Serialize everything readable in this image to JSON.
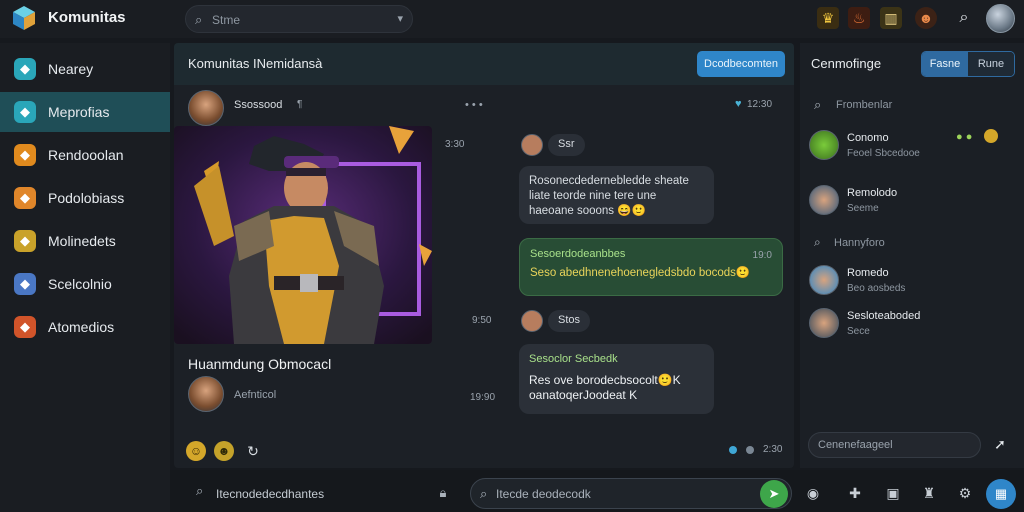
{
  "app": {
    "title": "Komunitas",
    "logo_icon": "cube-logo-icon"
  },
  "top_search": {
    "placeholder": "Stme"
  },
  "sidebar": {
    "items": [
      {
        "label": "Nearey",
        "icon": "home-icon",
        "color": "#2aa6b9"
      },
      {
        "label": "Meprofias",
        "icon": "chat-icon",
        "color": "#2aa6b9",
        "active": true
      },
      {
        "label": "Rendooolan",
        "icon": "coin-icon",
        "color": "#e08a1e"
      },
      {
        "label": "Podolobiass",
        "icon": "sword-icon",
        "color": "#e0862a"
      },
      {
        "label": "Molinedets",
        "icon": "star-icon",
        "color": "#c9a22a"
      },
      {
        "label": "Scelcolnio",
        "icon": "globe-icon",
        "color": "#4a77c4"
      },
      {
        "label": "Atomedios",
        "icon": "shield-icon",
        "color": "#d1542a"
      }
    ]
  },
  "main": {
    "title": "Komunitas INemidansà",
    "header_button": "Dcodbecomten",
    "author": {
      "name": "Ssossood",
      "flag": "¶"
    },
    "status_right": "12:30",
    "post_caption": "Huanmdung Obmocacl",
    "post_author": "Aefnticol",
    "messages": [
      {
        "time": "3:30",
        "name": "Ssr",
        "type": "chip"
      },
      {
        "text": "Rosonecdedernebledde sheate liate teorde nine tere une haeoane sooons 😄🙂",
        "type": "gray"
      },
      {
        "text_head": "Sesoerdodeanbbes",
        "time": "19:0",
        "text": "Seso abedhnenehoenegledsbdo bocods🙂",
        "type": "green"
      },
      {
        "time": "9:50",
        "name": "Stos",
        "type": "chip"
      },
      {
        "time": "19:90",
        "text_head": "Sesoclor Secbedk",
        "text": "Res ove borodecbsocolt🙂K oanatoqerJoodeat K",
        "type": "gray"
      }
    ],
    "footer": {
      "status": "2:30"
    }
  },
  "right": {
    "title": "Cenmofinge",
    "toggle": [
      "Fasne",
      "Rune"
    ],
    "search_placeholder": "Frombenlar",
    "group_label": "Hannyforo",
    "items": [
      {
        "name": "Conomo",
        "sub": "Feoel Sbcedooe"
      },
      {
        "name": "Remolodo",
        "sub": "Seeme"
      },
      {
        "name": "Romedo",
        "sub": "Beo aosbeds"
      },
      {
        "name": "Sesloteaboded",
        "sub": "Sece"
      }
    ],
    "input_placeholder": "Cenenefaageel"
  },
  "bottom": {
    "left_search": "Itecnodedecdhantes",
    "compose_placeholder": "Itecde deodecodk",
    "icons": [
      "discord-icon",
      "controller-icon",
      "tv-icon",
      "trophy-icon",
      "settings-icon",
      "camera-icon"
    ]
  }
}
